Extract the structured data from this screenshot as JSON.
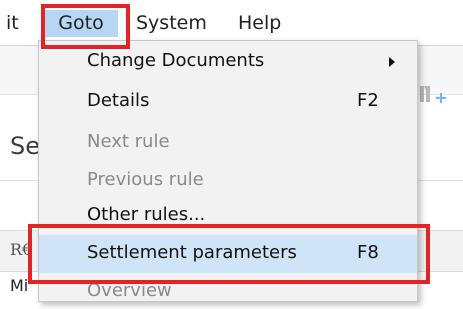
{
  "menubar": {
    "items": [
      {
        "id": "edit",
        "label": "it"
      },
      {
        "id": "goto",
        "label": "Goto"
      },
      {
        "id": "system",
        "label": "System"
      },
      {
        "id": "help",
        "label": "Help"
      }
    ]
  },
  "background": {
    "title_partial": "Se",
    "row_header_partial": "R€",
    "row_partial": "Mi"
  },
  "dropdown": {
    "items": [
      {
        "label": "Change Documents",
        "shortcut": "",
        "enabled": true,
        "submenu": true
      },
      {
        "label": "Details",
        "shortcut": "F2",
        "enabled": true,
        "submenu": false
      },
      {
        "label": "Next rule",
        "shortcut": "",
        "enabled": false,
        "submenu": false
      },
      {
        "label": "Previous rule",
        "shortcut": "",
        "enabled": false,
        "submenu": false
      },
      {
        "label": "Other rules...",
        "shortcut": "",
        "enabled": true,
        "submenu": false
      },
      {
        "label": "Settlement parameters",
        "shortcut": "F8",
        "enabled": true,
        "submenu": false,
        "selected": true
      },
      {
        "label": "Overview",
        "shortcut": "",
        "enabled": false,
        "submenu": false
      }
    ]
  },
  "colors": {
    "highlight_box": "#e22424",
    "menu_active_bg": "#b7d6f3",
    "selected_item_bg": "#cfe4f7"
  }
}
